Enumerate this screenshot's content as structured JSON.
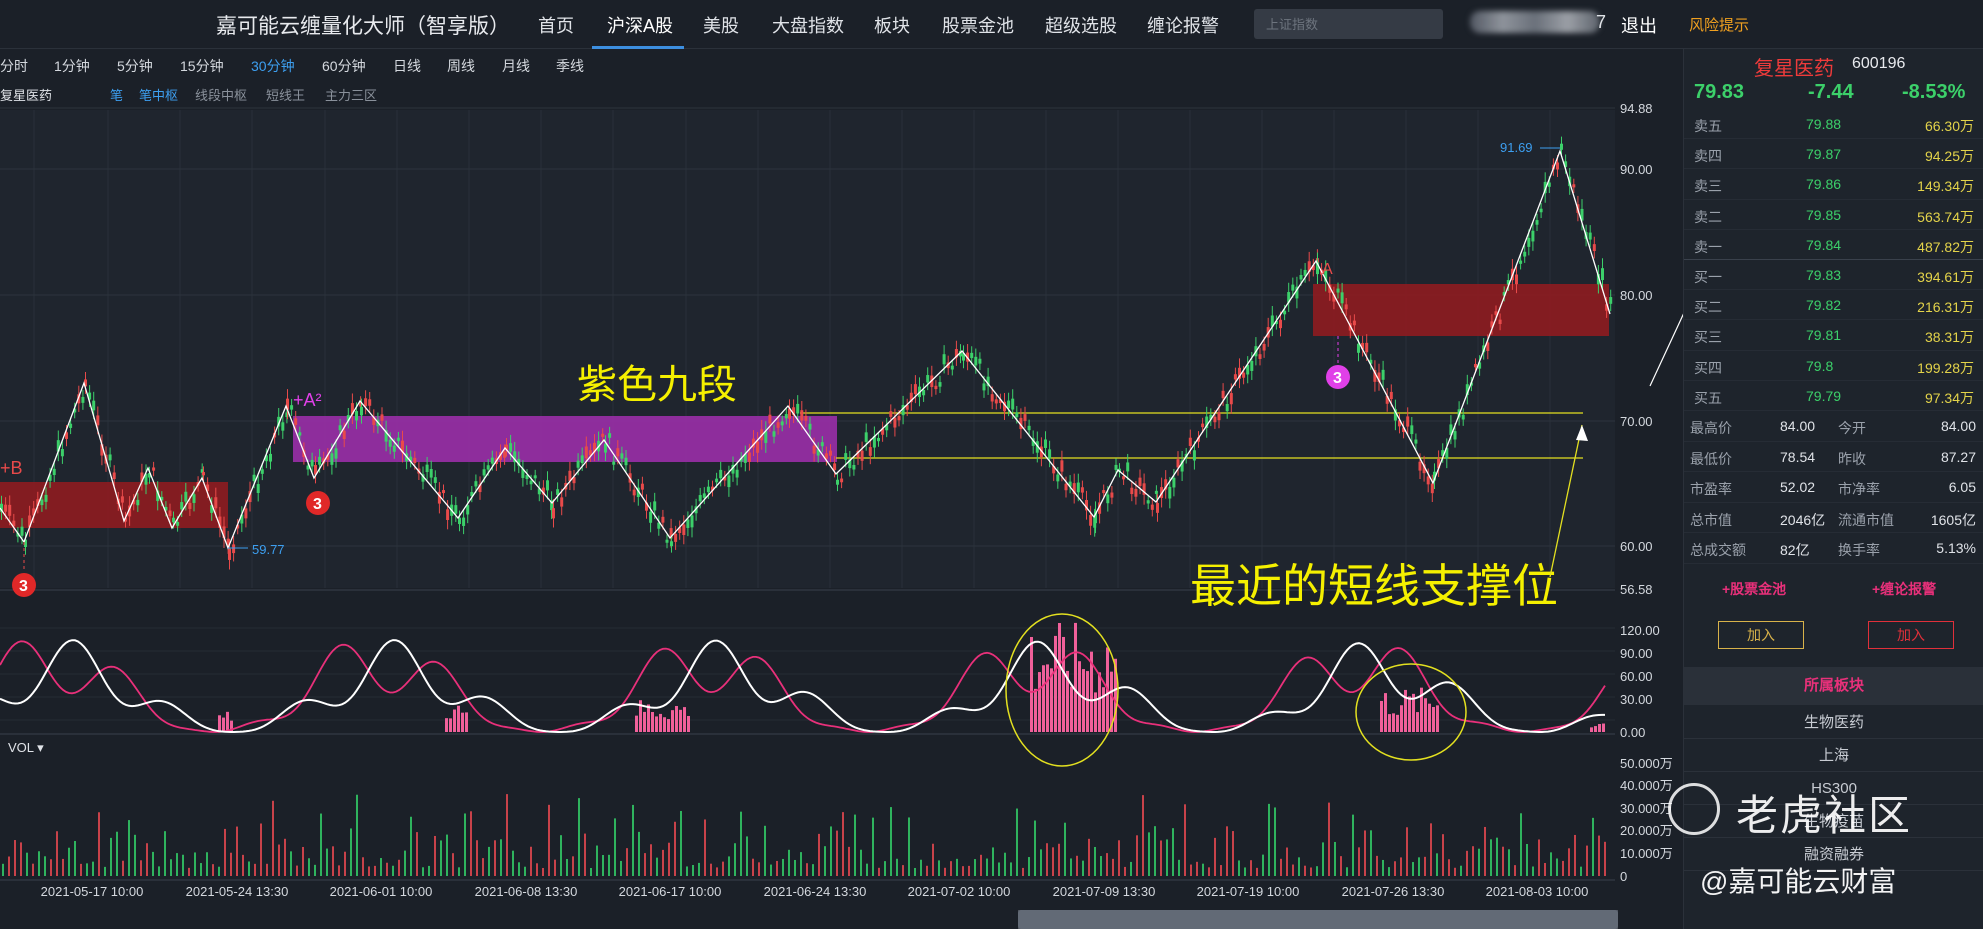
{
  "app_title": "嘉可能云缠量化大师（智享版）",
  "nav": [
    "首页",
    "沪深A股",
    "美股",
    "大盘指数",
    "板块",
    "股票金池",
    "超级选股",
    "缠论报警"
  ],
  "nav_active": "沪深A股",
  "search_placeholder": "上证指数",
  "user_suffix": "7",
  "logout": "退出",
  "risk": "风险提示",
  "periods": [
    "分时",
    "1分钟",
    "5分钟",
    "15分钟",
    "30分钟",
    "60分钟",
    "日线",
    "周线",
    "月线",
    "季线"
  ],
  "period_active": "30分钟",
  "stock_label": "复星医药",
  "indicators": [
    "笔",
    "笔中枢",
    "线段中枢",
    "短线王",
    "主力三区"
  ],
  "indicators_on": [
    "笔",
    "笔中枢"
  ],
  "annotations": {
    "purple": "紫色九段",
    "support": "最近的短线支撑位",
    "low_label": "59.77",
    "high_label": "91.69",
    "plus_b": "+B",
    "plus_a2": "+A²",
    "a_mark": "A",
    "badge": "3"
  },
  "price_axis": [
    "94.88",
    "90.00",
    "80.00",
    "70.00",
    "60.00",
    "56.58"
  ],
  "osc_axis": [
    "120.00",
    "90.00",
    "60.00",
    "30.00",
    "0.00"
  ],
  "vol_axis": [
    "50.000万",
    "40.000万",
    "30.000万",
    "20.000万",
    "10.000万",
    "0"
  ],
  "vol_label": "VOL",
  "dates": [
    "2021-05-17 10:00",
    "2021-05-24 13:30",
    "2021-06-01 10:00",
    "2021-06-08 13:30",
    "2021-06-17 10:00",
    "2021-06-24 13:30",
    "2021-07-02 10:00",
    "2021-07-09 13:30",
    "2021-07-19 10:00",
    "2021-07-26 13:30",
    "2021-08-03 10:00"
  ],
  "quote": {
    "name": "复星医药",
    "code": "600196",
    "price": "79.83",
    "change": "-7.44",
    "pct": "-8.53%"
  },
  "order_book": [
    {
      "label": "卖五",
      "price": "79.88",
      "vol": "66.30万"
    },
    {
      "label": "卖四",
      "price": "79.87",
      "vol": "94.25万"
    },
    {
      "label": "卖三",
      "price": "79.86",
      "vol": "149.34万"
    },
    {
      "label": "卖二",
      "price": "79.85",
      "vol": "563.74万"
    },
    {
      "label": "卖一",
      "price": "79.84",
      "vol": "487.82万"
    },
    {
      "label": "买一",
      "price": "79.83",
      "vol": "394.61万"
    },
    {
      "label": "买二",
      "price": "79.82",
      "vol": "216.31万"
    },
    {
      "label": "买三",
      "price": "79.81",
      "vol": "38.31万"
    },
    {
      "label": "买四",
      "price": "79.8",
      "vol": "199.28万"
    },
    {
      "label": "买五",
      "price": "79.79",
      "vol": "97.34万"
    }
  ],
  "stats": [
    {
      "l1": "最高价",
      "v1": "84.00",
      "l2": "今开",
      "v2": "84.00"
    },
    {
      "l1": "最低价",
      "v1": "78.54",
      "l2": "昨收",
      "v2": "87.27"
    },
    {
      "l1": "市盈率",
      "v1": "52.02",
      "l2": "市净率",
      "v2": "6.05"
    },
    {
      "l1": "总市值",
      "v1": "2046亿",
      "l2": "流通市值",
      "v2": "1605亿"
    },
    {
      "l1": "总成交额",
      "v1": "82亿",
      "l2": "换手率",
      "v2": "5.13%"
    }
  ],
  "links": {
    "pool": "+股票金池",
    "alarm": "+缠论报警",
    "add1": "加入",
    "add2": "加入"
  },
  "sector_title": "所属板块",
  "sectors": [
    "生物医药",
    "上海",
    "HS300",
    "生物疫苗",
    "融资融券"
  ],
  "watermark": {
    "name": "老虎社区",
    "sub": "@嘉可能云财富"
  },
  "colors": {
    "up": "#e84a4a",
    "down": "#3cd06a",
    "accent": "#3d9ff0",
    "pink": "#e8307a",
    "yellow": "#e3d34a",
    "purple": "#a030b0",
    "zone_red": "#a01e22"
  }
}
